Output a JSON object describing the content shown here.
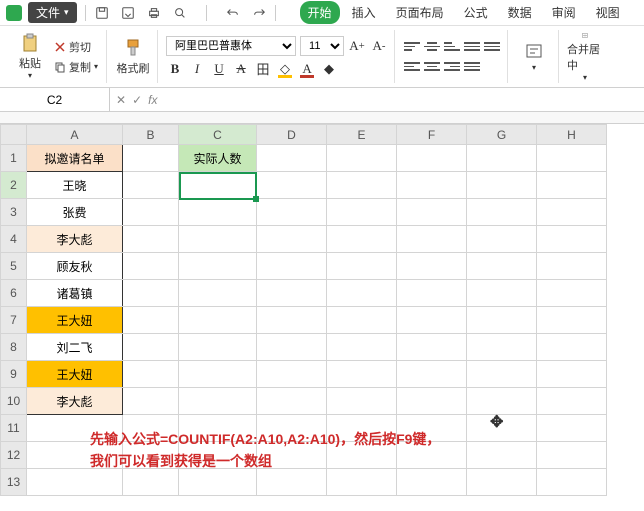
{
  "titlebar": {
    "file_label": "文件",
    "tabs": {
      "start": "开始",
      "insert": "插入",
      "layout": "页面布局",
      "formula": "公式",
      "data": "数据",
      "review": "审阅",
      "view": "视图"
    }
  },
  "ribbon": {
    "paste": "粘贴",
    "cut": "剪切",
    "copy": "复制",
    "format_painter": "格式刷",
    "font_name": "阿里巴巴普惠体",
    "font_size": "11",
    "merge_center": "合并居中"
  },
  "formula_bar": {
    "cell_ref": "C2",
    "fx": "fx",
    "value": ""
  },
  "columns": [
    "A",
    "B",
    "C",
    "D",
    "E",
    "F",
    "G",
    "H"
  ],
  "rows": [
    "1",
    "2",
    "3",
    "4",
    "5",
    "6",
    "7",
    "8",
    "9",
    "10",
    "11",
    "12",
    "13"
  ],
  "sheet": {
    "a1": "拟邀请名单",
    "c1": "实际人数",
    "a2": "王晓",
    "a3": "张费",
    "a4": "李大彪",
    "a5": "顾友秋",
    "a6": "诸葛镇",
    "a7": "王大妞",
    "a8": "刘二飞",
    "a9": "王大妞",
    "a10": "李大彪"
  },
  "annotation": {
    "line1": "先输入公式=COUNTIF(A2:A10,A2:A10)，然后按F9键，",
    "line2": "我们可以看到获得是一个数组"
  },
  "chart_data": {
    "type": "table",
    "columns": [
      "拟邀请名单"
    ],
    "rows": [
      [
        "王晓"
      ],
      [
        "张费"
      ],
      [
        "李大彪"
      ],
      [
        "顾友秋"
      ],
      [
        "诸葛镇"
      ],
      [
        "王大妞"
      ],
      [
        "刘二飞"
      ],
      [
        "王大妞"
      ],
      [
        "李大彪"
      ]
    ],
    "note": "Column C header '实际人数' with formula =COUNTIF(A2:A10,A2:A10) to be entered in C2"
  }
}
